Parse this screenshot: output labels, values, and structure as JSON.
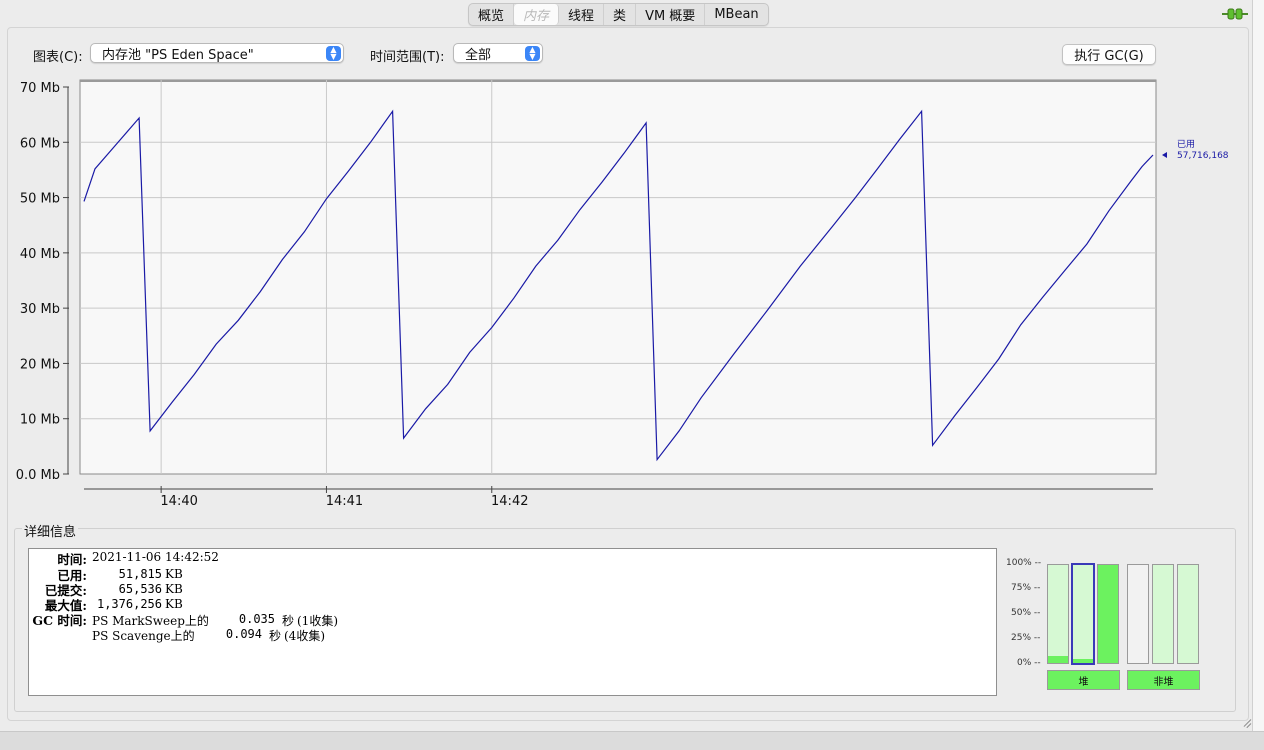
{
  "tabs": [
    {
      "label": "概览",
      "selected": false
    },
    {
      "label": "内存",
      "selected": true
    },
    {
      "label": "线程",
      "selected": false
    },
    {
      "label": "类",
      "selected": false
    },
    {
      "label": "VM 概要",
      "selected": false
    },
    {
      "label": "MBean",
      "selected": false
    }
  ],
  "controls": {
    "chart_label": "图表(C):",
    "chart_value": "内存池 \"PS Eden Space\"",
    "range_label": "时间范围(T):",
    "range_value": "全部",
    "gc_button": "执行 GC(G)"
  },
  "chart_data": {
    "type": "line",
    "series": [
      {
        "name": "已用",
        "color": "#1a1aa6",
        "points": [
          [
            "14:39:32",
            49.3
          ],
          [
            "14:39:36",
            55.2
          ],
          [
            "14:39:44",
            59.8
          ],
          [
            "14:39:52",
            64.4
          ],
          [
            "14:39:56",
            7.8
          ],
          [
            "14:40:04",
            13.0
          ],
          [
            "14:40:12",
            18.0
          ],
          [
            "14:40:20",
            23.5
          ],
          [
            "14:40:28",
            27.8
          ],
          [
            "14:40:36",
            33.0
          ],
          [
            "14:40:44",
            38.8
          ],
          [
            "14:40:52",
            43.8
          ],
          [
            "14:41:00",
            49.8
          ],
          [
            "14:41:08",
            54.8
          ],
          [
            "14:41:16",
            60.0
          ],
          [
            "14:41:24",
            65.6
          ],
          [
            "14:41:28",
            6.5
          ],
          [
            "14:41:36",
            11.8
          ],
          [
            "14:41:44",
            16.2
          ],
          [
            "14:41:52",
            22.0
          ],
          [
            "14:42:00",
            26.5
          ],
          [
            "14:42:08",
            31.8
          ],
          [
            "14:42:16",
            37.6
          ],
          [
            "14:42:24",
            42.3
          ],
          [
            "14:42:32",
            47.8
          ],
          [
            "14:42:40",
            52.8
          ],
          [
            "14:42:48",
            58.0
          ],
          [
            "14:42:56",
            63.5
          ],
          [
            "14:43:00",
            2.6
          ],
          [
            "14:43:08",
            7.8
          ],
          [
            "14:43:16",
            13.8
          ],
          [
            "14:43:28",
            21.8
          ],
          [
            "14:43:40",
            29.6
          ],
          [
            "14:43:52",
            37.6
          ],
          [
            "14:44:04",
            45.0
          ],
          [
            "14:44:12",
            50.0
          ],
          [
            "14:44:20",
            55.2
          ],
          [
            "14:44:28",
            60.5
          ],
          [
            "14:44:36",
            65.6
          ],
          [
            "14:44:40",
            5.2
          ],
          [
            "14:44:48",
            10.5
          ],
          [
            "14:44:56",
            15.6
          ],
          [
            "14:45:04",
            20.8
          ],
          [
            "14:45:12",
            27.0
          ],
          [
            "14:45:20",
            32.0
          ],
          [
            "14:45:28",
            36.8
          ],
          [
            "14:45:36",
            41.6
          ],
          [
            "14:45:44",
            47.6
          ],
          [
            "14:45:52",
            53.0
          ],
          [
            "14:45:56",
            55.6
          ],
          [
            "14:46:00",
            57.7
          ]
        ]
      }
    ],
    "x_domain": [
      "14:39:32",
      "14:46:00"
    ],
    "x_ticks": [
      "14:40",
      "14:41",
      "14:42"
    ],
    "y_ticks": [
      "0.0 Mb",
      "10 Mb",
      "20 Mb",
      "30 Mb",
      "40 Mb",
      "50 Mb",
      "60 Mb",
      "70 Mb"
    ],
    "ylim": [
      0,
      70
    ],
    "grid": true,
    "legend_name": "已用",
    "legend_value": "57,716,168"
  },
  "details": {
    "section_title": "详细信息",
    "time_key": "时间:",
    "time_value": "2021-11-06 14:42:52",
    "used_key": "已用:",
    "used_value": "51,815",
    "committed_key": "已提交:",
    "committed_value": "65,536",
    "max_key": "最大值:",
    "max_value": "1,376,256",
    "unit": "KB",
    "gc_key": "GC 时间:",
    "gc_rows": [
      {
        "name": "PS MarkSweep上的",
        "seconds": "0.035",
        "sec_unit": "秒",
        "count": "(1收集)"
      },
      {
        "name": "PS Scavenge上的",
        "seconds": "0.094",
        "sec_unit": "秒",
        "count": "(4收集)"
      }
    ]
  },
  "gauges": {
    "ticks": [
      "100% --",
      "75% --",
      "50% --",
      "25% --",
      "0% --"
    ],
    "heap_label": "堆",
    "nonheap_label": "非堆",
    "heap_levels": [
      0.07,
      0.04,
      1.0
    ],
    "nonheap_levels": [
      0.0,
      0.0,
      0.0
    ],
    "selected_index": 1
  }
}
